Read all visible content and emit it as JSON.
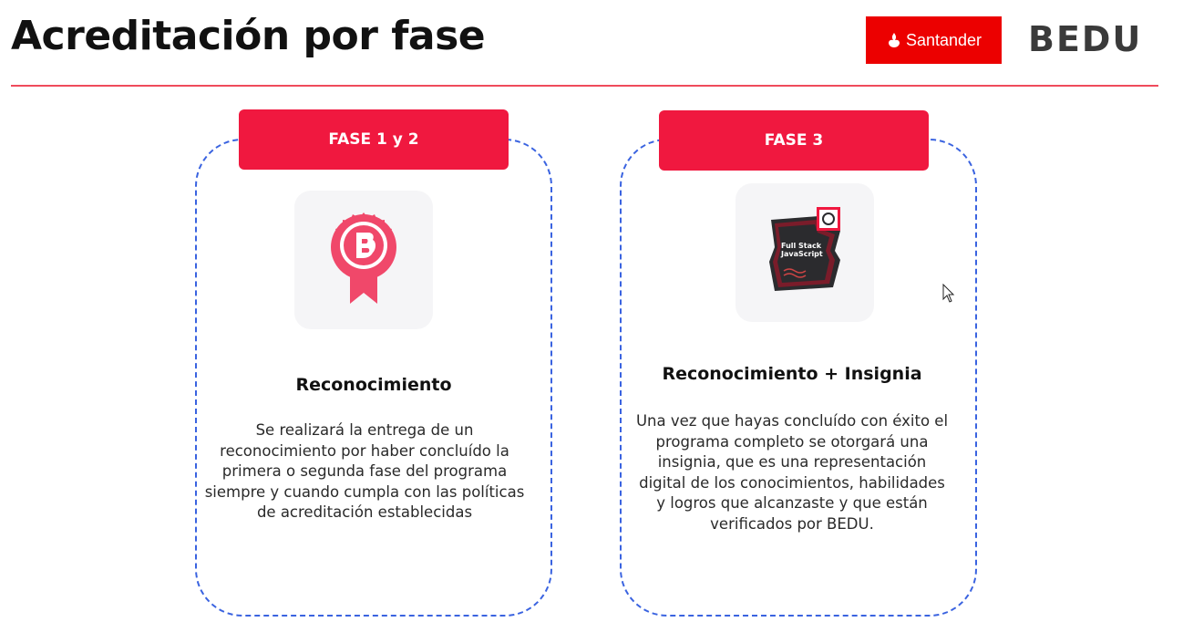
{
  "header": {
    "title": "Acreditación por fase",
    "santander_label": "Santander",
    "bedu_label": "BEDU"
  },
  "cards": [
    {
      "phase": "FASE 1 y 2",
      "title": "Reconocimiento",
      "body": "Se realizará la entrega de un reconocimiento por haber concluído la primera o segunda fase del programa siempre y cuando cumpla con las políticas de acreditación establecidas",
      "icon": "ribbon-award-icon"
    },
    {
      "phase": "FASE 3",
      "title": "Reconocimiento + Insignia",
      "body": "Una vez que hayas concluído con éxito el programa completo se otorgará una insignia, que es una representación digital de los conocimientos, habilidades y logros que alcanzaste y que están verificados por BEDU.",
      "icon": "digital-badge-icon",
      "badge_text": [
        "Full Stack",
        "JavaScript"
      ]
    }
  ],
  "colors": {
    "accent": "#f0183f",
    "divider": "#ef4b5c",
    "dashed_border": "#3a63e0",
    "santander": "#ec0000"
  }
}
